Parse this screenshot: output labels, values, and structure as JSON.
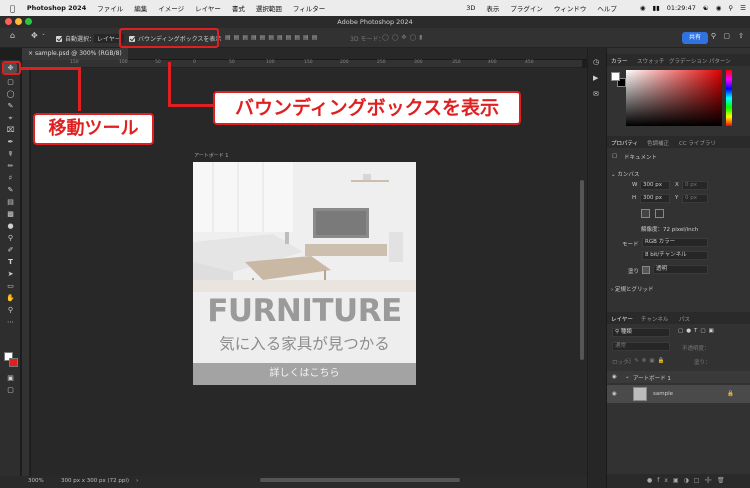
{
  "menubar": {
    "app_name": "Photoshop 2024",
    "items": [
      "ファイル",
      "編集",
      "イメージ",
      "レイヤー",
      "書式",
      "選択範囲",
      "フィルター",
      "3D",
      "表示",
      "プラグイン",
      "ウィンドウ",
      "ヘルプ"
    ],
    "clock": "01:29:47"
  },
  "window": {
    "title": "Adobe Photoshop 2024"
  },
  "options": {
    "auto_select": "自動選択：",
    "auto_select_target": "レイヤー",
    "bounding_box": "バウンディングボックスを表示",
    "mode_3d": "3D モード：",
    "share": "共有"
  },
  "document": {
    "tab": "sample.psd @ 300% (RGB/8)",
    "artboard_label": "アートボード 1",
    "zoom": "300%",
    "doc_info": "300 px x 300 px (72 ppi)",
    "ruler_ticks": [
      "150",
      "100",
      "50",
      "0",
      "50",
      "100",
      "150",
      "200",
      "250",
      "300",
      "350",
      "400",
      "450"
    ]
  },
  "artwork": {
    "headline": "FURNITURE",
    "subline": "気に入る家具が見つかる",
    "button": "詳しくはこちら"
  },
  "panels": {
    "color_tabs": [
      "カラー",
      "スウォッチ",
      "グラデーション",
      "パターン"
    ],
    "prop_tabs": [
      "プロパティ",
      "色調補正",
      "CC ライブラリ"
    ],
    "doc_type": "ドキュメント",
    "canvas_title": "カンバス",
    "w_label": "W",
    "w_value": "300 px",
    "h_label": "H",
    "h_value": "300 px",
    "x_label": "X",
    "y_label": "Y",
    "x_placeholder": "0 px",
    "y_placeholder": "0 px",
    "resolution": "解像度：72 pixel/inch",
    "mode_label": "モード",
    "mode_value": "RGB カラー",
    "depth_value": "8 bit/チャンネル",
    "fill_label": "塗り",
    "fill_value": "透明",
    "rulers_grid": "定規とグリッド",
    "layer_tabs": [
      "レイヤー",
      "チャンネル",
      "パス"
    ],
    "layer_filter": "種類",
    "blend_mode": "通常",
    "opacity": "不透明度：",
    "lock": "ロック：",
    "fill2": "塗り：",
    "artboard_layer": "アートボード 1",
    "layer_name": "sample"
  },
  "annotations": {
    "move_tool": "移動ツール",
    "bounding_box": "バウンディングボックスを表示"
  },
  "colors": {
    "accent": "#e02020",
    "share": "#2f72e0"
  }
}
